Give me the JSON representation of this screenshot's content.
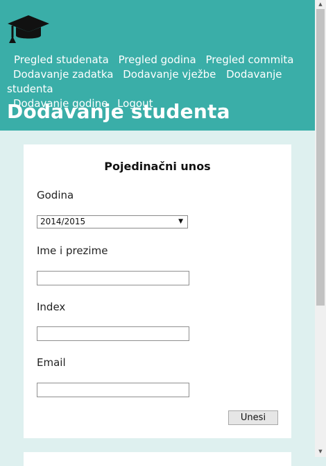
{
  "header": {
    "logo_icon": "graduation-cap-icon",
    "nav": [
      {
        "label": "Pregled studenata"
      },
      {
        "label": "Pregled godina"
      },
      {
        "label": "Pregled commita"
      },
      {
        "label": "Dodavanje zadatka"
      },
      {
        "label": "Dodavanje vježbe"
      },
      {
        "label": "Dodavanje studenta"
      },
      {
        "label": "Dodavanje godine"
      },
      {
        "label": "Logout"
      }
    ],
    "title": "Dodavanje studenta"
  },
  "form": {
    "heading": "Pojedinačni unos",
    "year_label": "Godina",
    "year_value": "2014/2015",
    "name_label": "Ime i prezime",
    "name_value": "",
    "index_label": "Index",
    "index_value": "",
    "email_label": "Email",
    "email_value": "",
    "submit_label": "Unesi"
  },
  "colors": {
    "header_bg": "#3aaea8",
    "page_bg": "#def0ef",
    "card_bg": "#ffffff"
  }
}
